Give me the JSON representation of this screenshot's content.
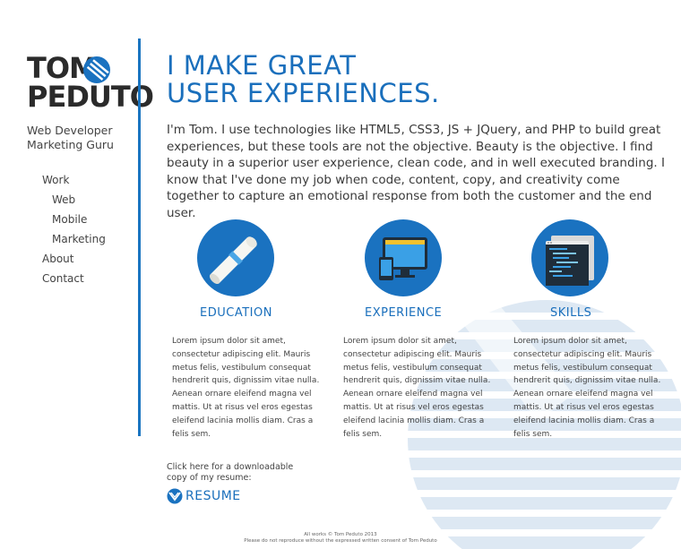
{
  "logo": {
    "line1": "TOM",
    "line2": "PEDUTO"
  },
  "tagline": {
    "line1": "Web Developer",
    "line2": "Marketing Guru"
  },
  "nav": [
    {
      "label": "Work",
      "sub": false
    },
    {
      "label": "Web",
      "sub": true
    },
    {
      "label": "Mobile",
      "sub": true
    },
    {
      "label": "Marketing",
      "sub": true
    },
    {
      "label": "About",
      "sub": false
    },
    {
      "label": "Contact",
      "sub": false
    }
  ],
  "headline": {
    "line1": "I MAKE GREAT",
    "line2": "USER EXPERIENCES."
  },
  "intro": "I'm Tom. I use technologies like HTML5, CSS3, JS + JQuery, and PHP to build great experiences, but these tools are not the objective. Beauty is the objective. I find beauty in a superior user experience, clean code, and in well executed branding. I know that I've done my job when code, content, copy, and creativity come together to capture an emotional response from both the customer and the end user.",
  "cards": [
    {
      "title": "EDUCATION",
      "icon": "diploma-icon",
      "body": "Lorem ipsum dolor sit amet, consectetur adipiscing elit. Mauris metus felis, vestibulum consequat hendrerit quis, dignissim vitae nulla. Aenean ornare eleifend magna vel mattis. Ut at risus vel eros egestas eleifend lacinia mollis diam. Cras a felis sem."
    },
    {
      "title": "EXPERIENCE",
      "icon": "devices-icon",
      "body": "Lorem ipsum dolor sit amet, consectetur adipiscing elit. Mauris metus felis, vestibulum consequat hendrerit quis, dignissim vitae nulla. Aenean ornare eleifend magna vel mattis. Ut at risus vel eros egestas eleifend lacinia mollis diam. Cras a felis sem."
    },
    {
      "title": "SKILLS",
      "icon": "code-editor-icon",
      "body": "Lorem ipsum dolor sit amet, consectetur adipiscing elit. Mauris metus felis, vestibulum consequat hendrerit quis, dignissim vitae nulla. Aenean ornare eleifend magna vel mattis. Ut at risus vel eros egestas eleifend lacinia mollis diam. Cras a felis sem."
    }
  ],
  "resume": {
    "note_line1": "Click here for a downloadable",
    "note_line2": "copy of my resume:",
    "label": "RESUME"
  },
  "footer": {
    "line1": "All works © Tom Peduto 2013",
    "line2": "Please do not reproduce without the expressed written consent of Tom Peduto"
  },
  "colors": {
    "accent": "#1a72c0",
    "watermark": "#dde8f3",
    "text": "#3a3a3a"
  }
}
